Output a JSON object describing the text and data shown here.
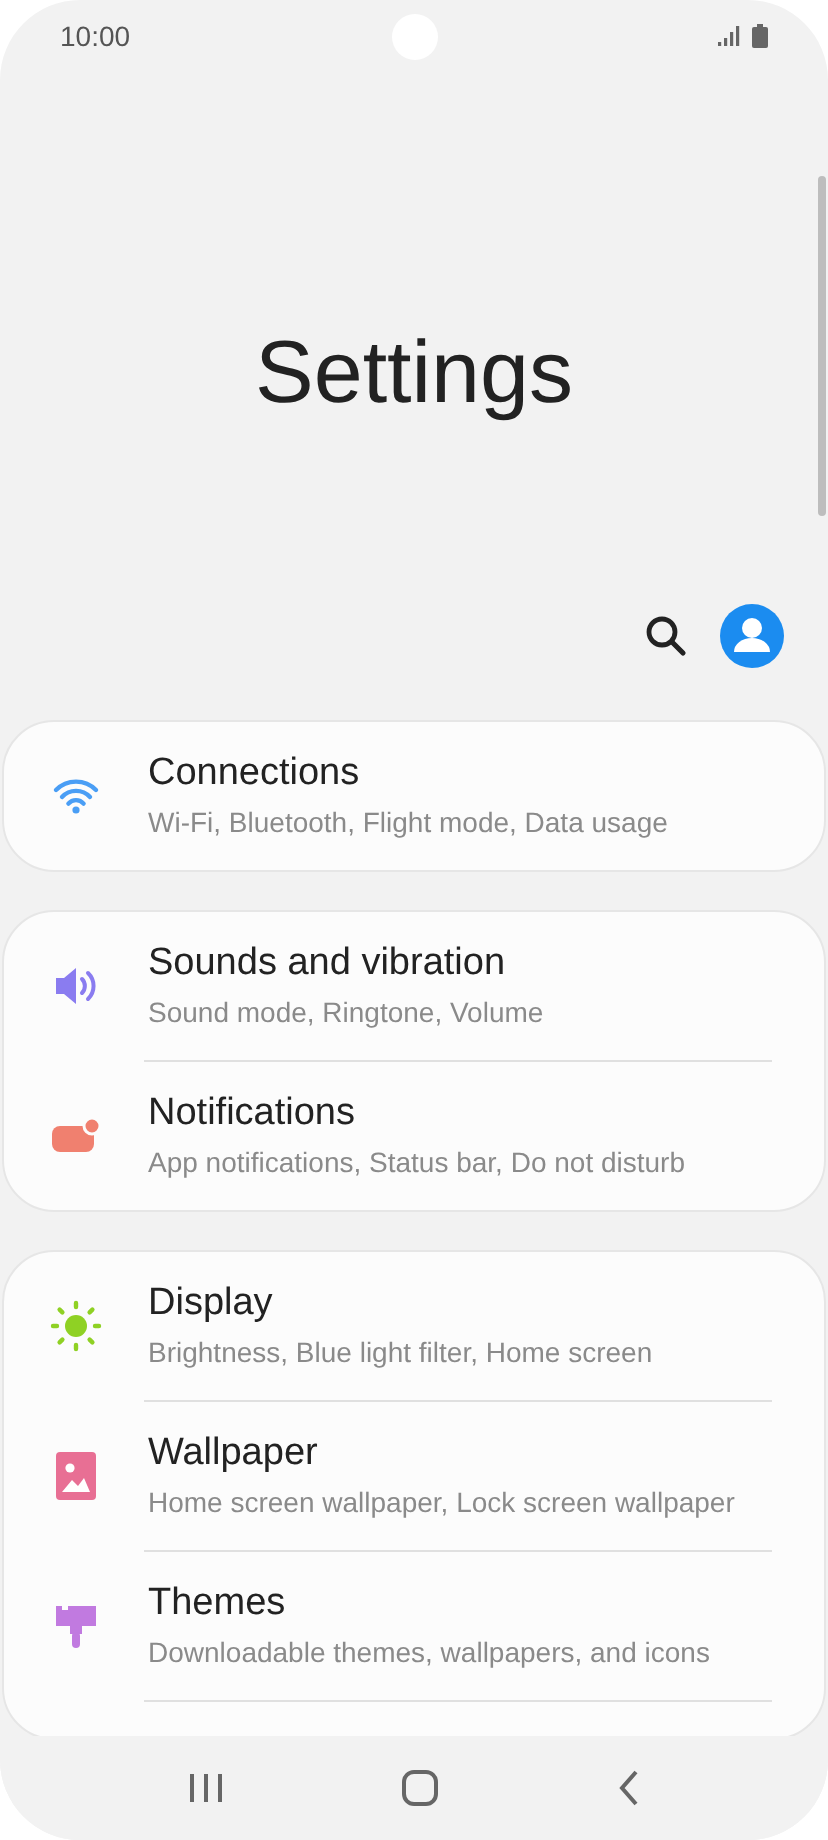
{
  "status_bar": {
    "time": "10:00"
  },
  "title": "Settings",
  "groups": [
    {
      "more_below": false,
      "items": [
        {
          "kind": "wifi",
          "label": "Connections",
          "summary": "Wi-Fi, Bluetooth, Flight mode, Data usage"
        }
      ]
    },
    {
      "more_below": false,
      "items": [
        {
          "kind": "sound",
          "label": "Sounds and vibration",
          "summary": "Sound mode, Ringtone, Volume"
        },
        {
          "kind": "notifications",
          "label": "Notifications",
          "summary": "App notifications, Status bar, Do not disturb"
        }
      ]
    },
    {
      "more_below": true,
      "items": [
        {
          "kind": "display",
          "label": "Display",
          "summary": "Brightness, Blue light filter, Home screen"
        },
        {
          "kind": "wallpaper",
          "label": "Wallpaper",
          "summary": "Home screen wallpaper, Lock screen wallpaper"
        },
        {
          "kind": "themes",
          "label": "Themes",
          "summary": "Downloadable themes, wallpapers, and icons"
        }
      ]
    }
  ]
}
